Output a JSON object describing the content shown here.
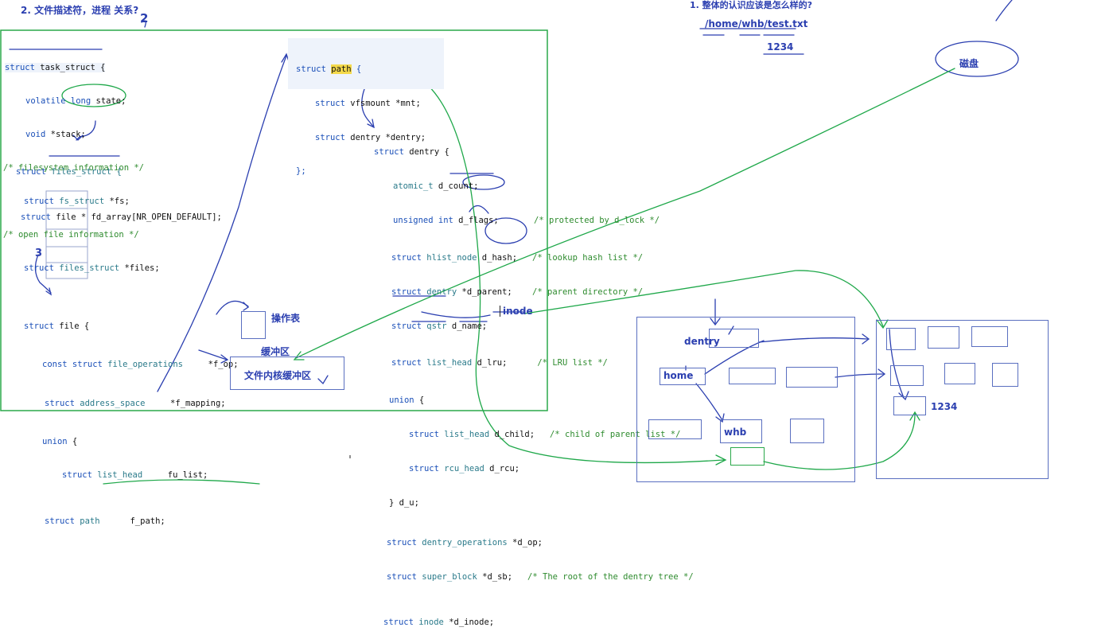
{
  "headings": {
    "q2": "2. 文件描述符，进程 关系?",
    "q1": "1. 整体的认识应该是怎么样的?",
    "path": "/home/whb/test.txt",
    "content": "1234"
  },
  "annotations": {
    "num2": "2",
    "num3": "3",
    "disk": "磁盘",
    "op_table": "操作表",
    "buffer": "缓冲区",
    "kernel_buffer": "文件内核缓冲区",
    "inode": "inode",
    "dentry": "dentry",
    "home": "home",
    "whb": "whb",
    "data_1234": "1234"
  },
  "task_struct": {
    "l1_kw": "struct",
    "l1_name": " task_struct {",
    "l2_kw": "volatile long",
    "l2_rest": " state;",
    "l3_kw": "void",
    "l3_rest": " *stack;",
    "l4": "/* filesystem information */",
    "l5_kw": "struct",
    "l5_ty": " fs_struct",
    "l5_rest": " *fs;",
    "l6": "/* open file information */",
    "l7_kw": "struct",
    "l7_ty": " files_struct",
    "l7_rest": " *files;"
  },
  "files_struct": {
    "l1_kw": "struct",
    "l1_name": " files_struct {",
    "l2_kw": "struct",
    "l2_rest": " file * fd_array[NR_OPEN_DEFAULT];"
  },
  "file_struct": {
    "l1_kw": "struct",
    "l1_name": " file {",
    "l2_kw": "const struct",
    "l2_ty": " file_operations",
    "l2_rest": "     *f_op;",
    "l3_kw": "struct",
    "l3_ty": " address_space",
    "l3_rest": "     *f_mapping;",
    "l4_kw": "union",
    "l4_rest": " {",
    "l5_kw": "struct",
    "l5_ty": " list_head",
    "l5_rest": "     fu_list;",
    "l6_kw": "struct",
    "l6_ty": " path",
    "l6_rest": "      f_path;"
  },
  "path_struct": {
    "l1_kw": "struct",
    "l1_name": "path",
    "l1_rest": " {",
    "l2_kw": "struct",
    "l2_rest": " vfsmount *mnt;",
    "l3_kw": "struct",
    "l3_rest": " dentry *dentry;",
    "l4": "};"
  },
  "dentry_struct": {
    "l1_kw": "struct",
    "l1_rest": " dentry {",
    "l2_ty": "atomic_t",
    "l2_rest": " d_count;",
    "l3_kw": "unsigned int",
    "l3_rest": " d_flags;",
    "l3_cm": "/* protected by d_lock */",
    "l4_kw": "struct",
    "l4_ty": " hlist_node",
    "l4_rest": " d_hash;",
    "l4_cm": "/* lookup hash list */",
    "l5_kw": "struct",
    "l5_ty": " dentry",
    "l5_rest": " *d_parent;",
    "l5_cm": "/* parent directory */",
    "l6_kw": "struct",
    "l6_ty": " qstr",
    "l6_rest": " d_name;",
    "l7_kw": "struct",
    "l7_ty": " list_head",
    "l7_rest": " d_lru;",
    "l7_cm": "/* LRU list */",
    "l8_kw": "union",
    "l8_rest": " {",
    "l9_kw": "struct",
    "l9_ty": " list_head",
    "l9_rest": " d_child;",
    "l9_cm": "/* child of parent list */",
    "l10_kw": "struct",
    "l10_ty": " rcu_head",
    "l10_rest": " d_rcu;",
    "l11": "} d_u;",
    "l12_kw": "struct",
    "l12_ty": " dentry_operations",
    "l12_rest": " *d_op;",
    "l13_kw": "struct",
    "l13_ty": " super_block",
    "l13_rest": " *d_sb;",
    "l13_cm": "/* The root of the dentry tree */",
    "l14_kw": "struct",
    "l14_ty": " inode",
    "l14_rest": " *d_inode;"
  },
  "colors": {
    "green_frame": "#2aa84a",
    "pen_blue": "#2b3fb0",
    "pen_green": "#1fa84a"
  }
}
